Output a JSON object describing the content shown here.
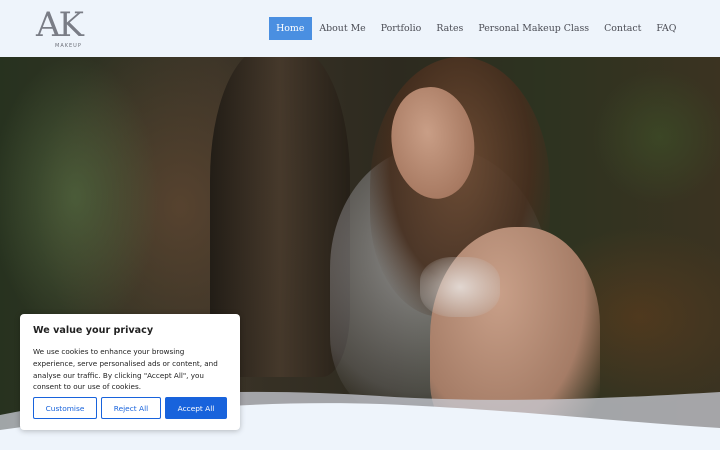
{
  "header": {
    "logo_text": "AK",
    "logo_subtitle": "MAKEUP",
    "nav": [
      {
        "label": "Home",
        "active": true
      },
      {
        "label": "About Me",
        "active": false
      },
      {
        "label": "Portfolio",
        "active": false
      },
      {
        "label": "Rates",
        "active": false
      },
      {
        "label": "Personal Makeup Class",
        "active": false
      },
      {
        "label": "Contact",
        "active": false
      },
      {
        "label": "FAQ",
        "active": false
      }
    ],
    "active_color": "#4a8fe1"
  },
  "cookie_banner": {
    "title": "We value your privacy",
    "text": "We use cookies to enhance your browsing experience, serve personalised ads or content, and analyse our traffic. By clicking \"Accept All\", you consent to our use of cookies.",
    "customise_label": "Customise",
    "reject_label": "Reject All",
    "accept_label": "Accept All",
    "accent_color": "#1863dc"
  }
}
